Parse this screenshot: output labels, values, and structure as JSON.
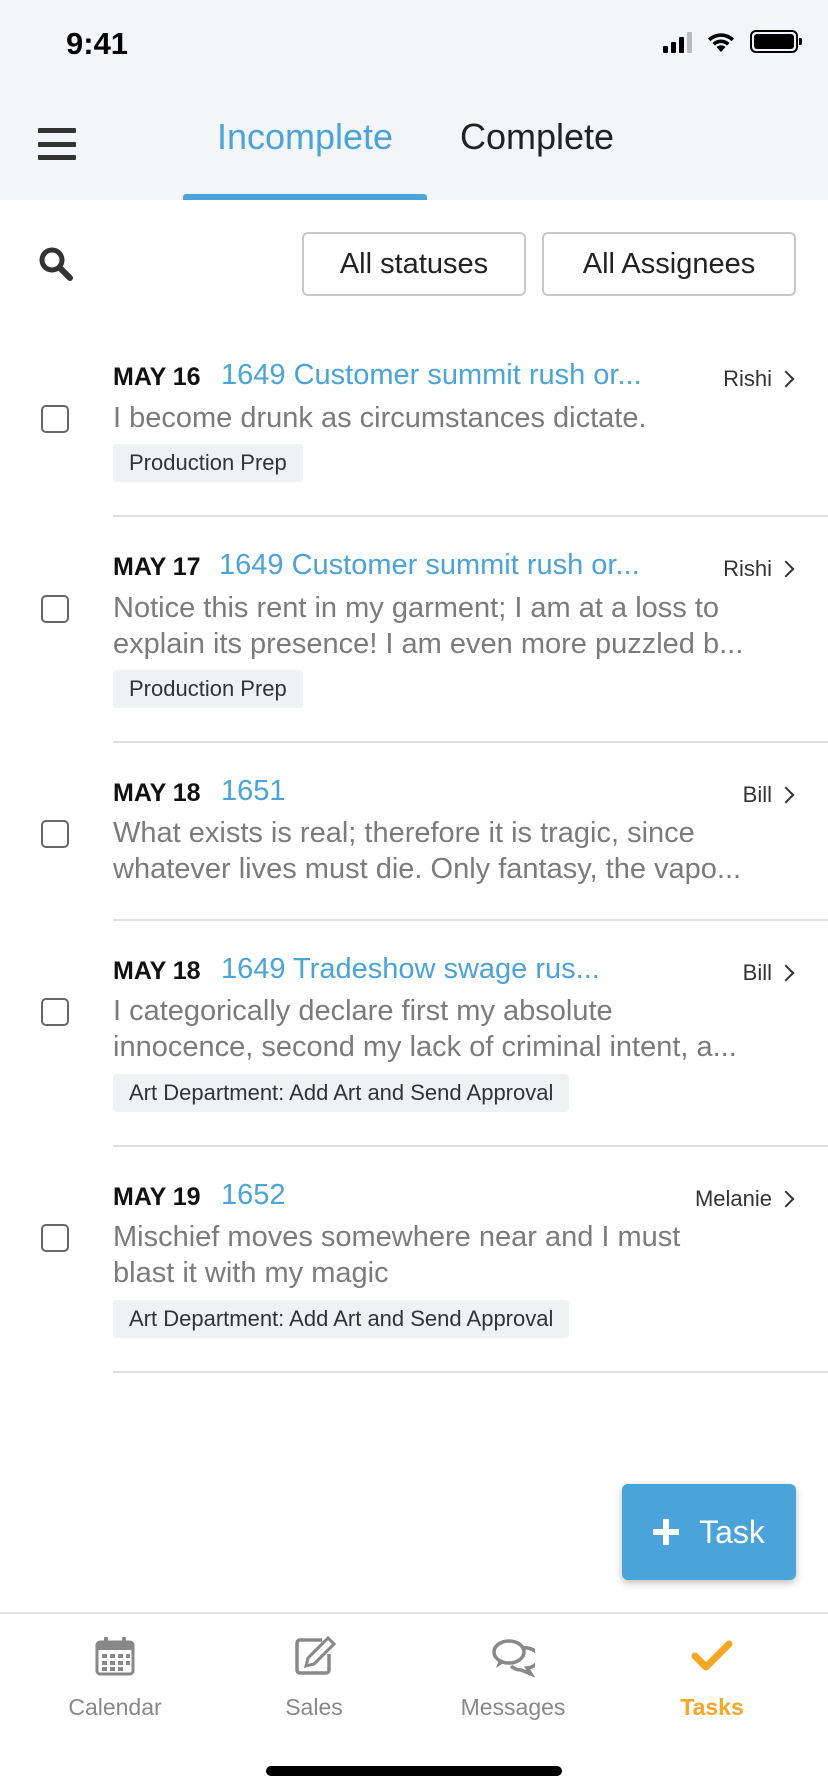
{
  "status_bar": {
    "time": "9:41"
  },
  "header": {
    "tabs": [
      {
        "label": "Incomplete",
        "active": true
      },
      {
        "label": "Complete",
        "active": false
      }
    ]
  },
  "filters": {
    "status_label": "All statuses",
    "assignee_label": "All Assignees"
  },
  "tasks": [
    {
      "date": "MAY 16",
      "title": "1649 Customer summit rush or...",
      "assignee": "Rishi",
      "desc": [
        "I become drunk as circumstances dictate."
      ],
      "tag": "Production Prep"
    },
    {
      "date": "MAY 17",
      "title": "1649 Customer summit rush or...",
      "assignee": "Rishi",
      "desc": [
        "Notice this rent in my garment; I am at a loss to",
        "explain its presence! I am even more puzzled b..."
      ],
      "tag": "Production Prep"
    },
    {
      "date": "MAY 18",
      "title": "1651",
      "assignee": "Bill",
      "desc": [
        "What exists is real; therefore it is tragic, since",
        "whatever lives must die. Only fantasy, the vapo..."
      ],
      "tag": ""
    },
    {
      "date": "MAY 18",
      "title": "1649 Tradeshow swage rus...",
      "assignee": "Bill",
      "desc": [
        "I categorically declare first my absolute",
        "innocence, second my lack of criminal intent, a..."
      ],
      "tag": "Art Department: Add Art and Send Approval"
    },
    {
      "date": "MAY 19",
      "title": "1652",
      "assignee": "Melanie",
      "desc": [
        "Mischief moves somewhere near and I must",
        "blast it with my magic"
      ],
      "tag": "Art Department: Add Art and Send Approval"
    }
  ],
  "add_task_label": "Task",
  "nav": [
    {
      "label": "Calendar",
      "icon": "calendar-icon",
      "active": false
    },
    {
      "label": "Sales",
      "icon": "edit-icon",
      "active": false
    },
    {
      "label": "Messages",
      "icon": "chat-icon",
      "active": false
    },
    {
      "label": "Tasks",
      "icon": "check-icon",
      "active": true
    }
  ],
  "colors": {
    "accent": "#4aa3d9",
    "active_nav": "#f5a623",
    "muted": "#7b7b7b"
  }
}
